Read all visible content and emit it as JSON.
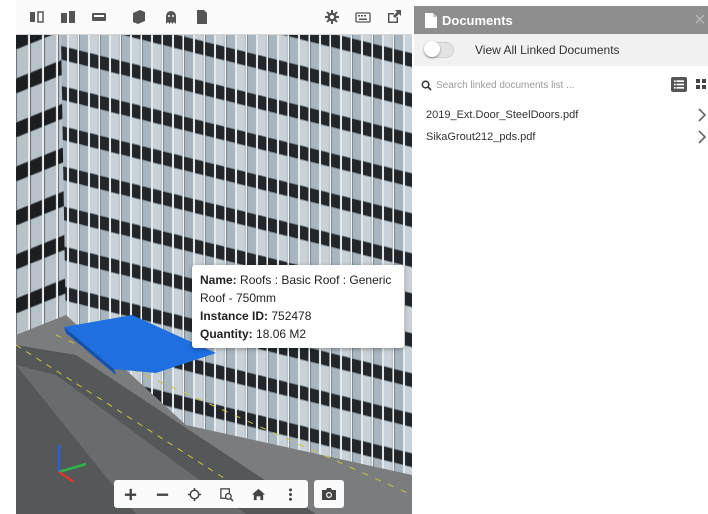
{
  "viewer": {
    "toolbar_icons": [
      "split-view-icon",
      "cabinet-icon",
      "keyboard-panel-icon",
      "cube-icon",
      "ghost-icon",
      "document-icon",
      "settings-gear-icon",
      "keyboard-icon",
      "external-link-icon"
    ],
    "tooltip": {
      "name_label": "Name:",
      "name_value": "Roofs : Basic Roof : Generic Roof - 750mm",
      "id_label": "Instance ID:",
      "id_value": "752478",
      "quantity_label": "Quantity:",
      "quantity_value": "18.06 M2"
    },
    "bottom_tools": [
      "zoom-in-icon",
      "zoom-out-icon",
      "fit-view-icon",
      "zoom-window-icon",
      "home-icon",
      "more-icon"
    ],
    "camera_tool": "camera-icon"
  },
  "panel": {
    "title": "Documents",
    "toggle_label": "View All Linked Documents",
    "toggle_on": false,
    "search_placeholder": "Search linked documents list ...",
    "documents": [
      {
        "name": "2019_Ext.Door_SteelDoors.pdf"
      },
      {
        "name": "SikaGrout212_pds.pdf"
      }
    ]
  },
  "colors": {
    "panel_header": "#8e8e8e",
    "highlight_roof": "#1e6fe0",
    "axis_x": "#2db54a",
    "axis_y": "#2a5fd6",
    "axis_z": "#d43a2a"
  }
}
